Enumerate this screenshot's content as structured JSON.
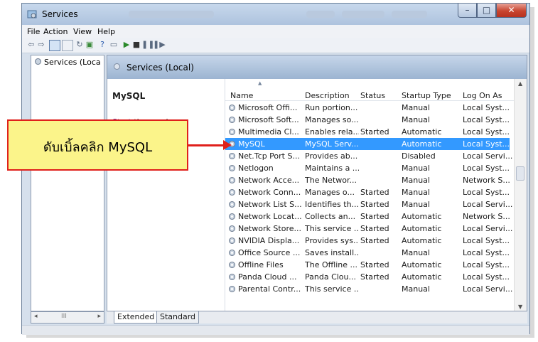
{
  "window": {
    "title": "Services",
    "colors": {
      "accent": "#3399ff",
      "callout_border": "#e0201b",
      "callout_fill": "#fbf48a"
    }
  },
  "menu": [
    "File",
    "Action",
    "View",
    "Help"
  ],
  "tree": {
    "node_label": "Services (Loca"
  },
  "pane": {
    "header": "Services (Local)",
    "selected_service": "MySQL",
    "action_link": "Start",
    "action_rest": " the service"
  },
  "columns": [
    "Name",
    "Description",
    "Status",
    "Startup Type",
    "Log On As"
  ],
  "rows": [
    {
      "name": "Microsoft Offi...",
      "desc": "Run portion...",
      "status": "",
      "startup": "Manual",
      "logon": "Local Syst..."
    },
    {
      "name": "Microsoft Soft...",
      "desc": "Manages so...",
      "status": "",
      "startup": "Manual",
      "logon": "Local Syst..."
    },
    {
      "name": "Multimedia Cl...",
      "desc": "Enables rela...",
      "status": "Started",
      "startup": "Automatic",
      "logon": "Local Syst..."
    },
    {
      "name": "MySQL",
      "desc": "MySQL Serv...",
      "status": "",
      "startup": "Automatic",
      "logon": "Local Syst..."
    },
    {
      "name": "Net.Tcp Port S...",
      "desc": "Provides ab...",
      "status": "",
      "startup": "Disabled",
      "logon": "Local Servi..."
    },
    {
      "name": "Netlogon",
      "desc": "Maintains a ...",
      "status": "",
      "startup": "Manual",
      "logon": "Local Syst..."
    },
    {
      "name": "Network Acce...",
      "desc": "The Networ...",
      "status": "",
      "startup": "Manual",
      "logon": "Network S..."
    },
    {
      "name": "Network Conn...",
      "desc": "Manages o...",
      "status": "Started",
      "startup": "Manual",
      "logon": "Local Syst..."
    },
    {
      "name": "Network List S...",
      "desc": "Identifies th...",
      "status": "Started",
      "startup": "Manual",
      "logon": "Local Servi..."
    },
    {
      "name": "Network Locat...",
      "desc": "Collects an...",
      "status": "Started",
      "startup": "Automatic",
      "logon": "Network S..."
    },
    {
      "name": "Network Store...",
      "desc": "This service ...",
      "status": "Started",
      "startup": "Automatic",
      "logon": "Local Servi..."
    },
    {
      "name": "NVIDIA Displa...",
      "desc": "Provides sys...",
      "status": "Started",
      "startup": "Automatic",
      "logon": "Local Syst..."
    },
    {
      "name": "Office Source ...",
      "desc": "Saves install...",
      "status": "",
      "startup": "Manual",
      "logon": "Local Syst..."
    },
    {
      "name": "Offline Files",
      "desc": "The Offline ...",
      "status": "Started",
      "startup": "Automatic",
      "logon": "Local Syst..."
    },
    {
      "name": "Panda Cloud ...",
      "desc": "Panda Clou...",
      "status": "Started",
      "startup": "Automatic",
      "logon": "Local Syst..."
    },
    {
      "name": "Parental Contr...",
      "desc": "This service ...",
      "status": "",
      "startup": "Manual",
      "logon": "Local Servi..."
    }
  ],
  "tabs": [
    "Extended",
    "Standard"
  ],
  "callout": {
    "text": "ดับเบิ้ลคลิก MySQL"
  }
}
